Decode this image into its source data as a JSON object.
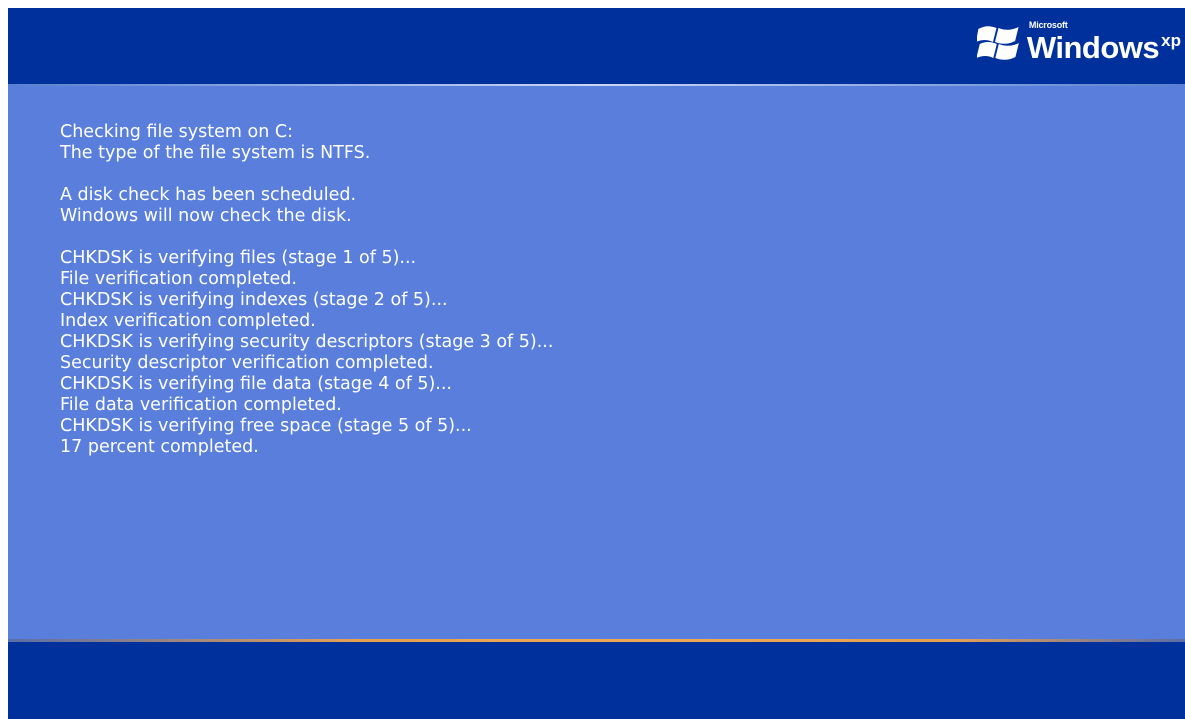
{
  "brand": {
    "microsoft_label": "Microsoft",
    "windows_label": "Windows",
    "xp_label": "xp"
  },
  "console": {
    "lines": [
      "Checking file system on C:",
      "The type of the file system is NTFS.",
      "",
      "A disk check has been scheduled.",
      "Windows will now check the disk.",
      "",
      "CHKDSK is verifying files (stage 1 of 5)...",
      "File verification completed.",
      "CHKDSK is verifying indexes (stage 2 of 5)...",
      "Index verification completed.",
      "CHKDSK is verifying security descriptors (stage 3 of 5)...",
      "Security descriptor verification completed.",
      "CHKDSK is verifying file data (stage 4 of 5)...",
      "File data verification completed.",
      "CHKDSK is verifying free space (stage 5 of 5)...",
      "17 percent completed."
    ],
    "progress_percent": 17
  },
  "colors": {
    "bar_blue": "#00309c",
    "content_blue": "#5a7edc",
    "accent_orange": "#f0a858",
    "text": "#ffffff"
  },
  "icons": {
    "logo": "windows-flag-icon"
  }
}
